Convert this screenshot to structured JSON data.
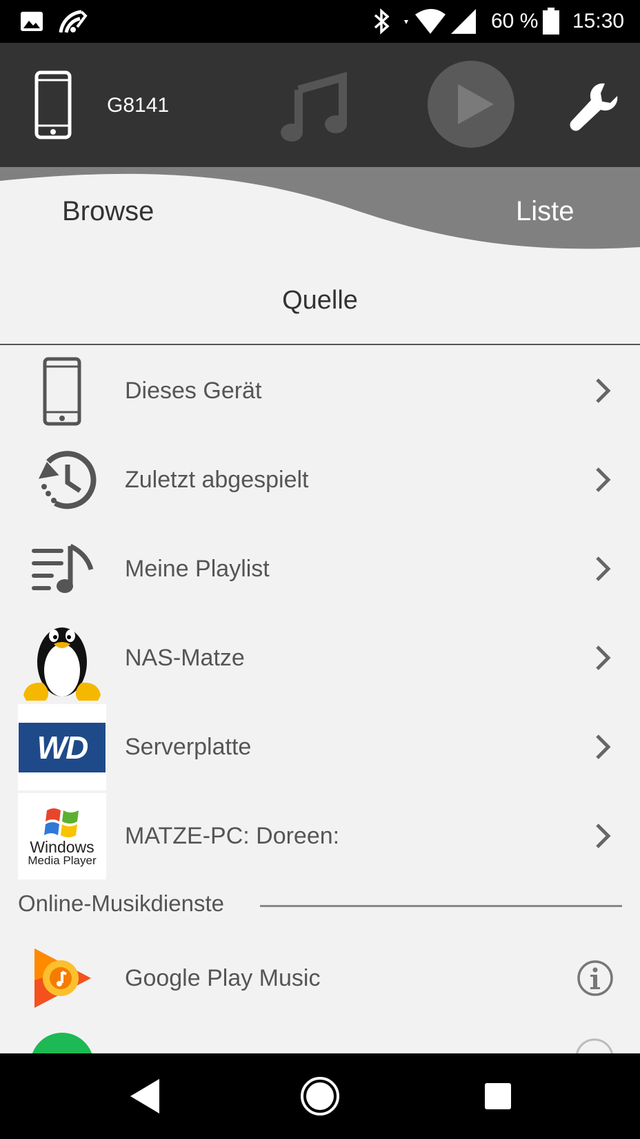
{
  "status_bar": {
    "battery_percent": "60 %",
    "time": "15:30"
  },
  "top_bar": {
    "device_name": "G8141"
  },
  "tabs": {
    "browse": "Browse",
    "liste": "Liste"
  },
  "section": {
    "title": "Quelle"
  },
  "sources": [
    {
      "label": "Dieses Gerät",
      "icon": "phone-icon"
    },
    {
      "label": "Zuletzt abgespielt",
      "icon": "history-icon"
    },
    {
      "label": "Meine Playlist",
      "icon": "playlist-icon"
    },
    {
      "label": "NAS-Matze",
      "icon": "tux-penguin-icon"
    },
    {
      "label": "Serverplatte",
      "icon": "wd-logo-icon"
    },
    {
      "label": "MATZE-PC: Doreen:",
      "icon": "windows-media-player-icon"
    }
  ],
  "online_group": {
    "label": "Online-Musikdienste"
  },
  "services": [
    {
      "label": "Google Play Music",
      "icon": "google-play-music-icon"
    }
  ],
  "logos": {
    "wd": "WD",
    "wmp_line1": "Windows",
    "wmp_line2": "Media Player"
  }
}
